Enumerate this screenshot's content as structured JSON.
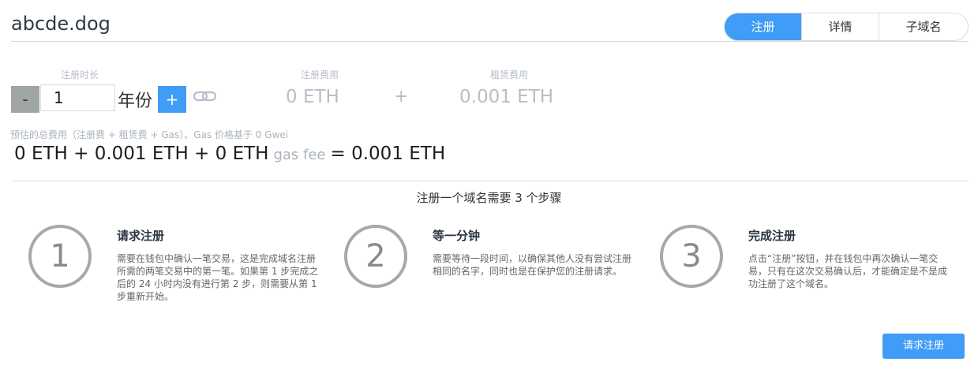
{
  "header": {
    "domain": "abcde.dog",
    "tabs": [
      {
        "label": "注册",
        "active": true
      },
      {
        "label": "详情",
        "active": false
      },
      {
        "label": "子域名",
        "active": false
      }
    ]
  },
  "registration": {
    "duration_label": "注册时长",
    "duration_value": "1",
    "duration_unit": "年份",
    "decrement_label": "-",
    "increment_label": "+",
    "reg_fee_label": "注册费用",
    "reg_fee_value": "0 ETH",
    "plus_symbol": "+",
    "rent_fee_label": "租赁费用",
    "rent_fee_value": "0.001 ETH",
    "estimate_note": "预估的总费用（注册费 + 租赁费 + Gas）。Gas 价格基于 0 Gwei",
    "total": {
      "part1": "0 ETH + 0.001 ETH + 0 ETH",
      "gas_label": "gas fee",
      "part2": "= 0.001 ETH"
    }
  },
  "steps": {
    "heading": "注册一个域名需要 3 个步骤",
    "items": [
      {
        "number": "1",
        "title": "请求注册",
        "desc": "需要在钱包中确认一笔交易，这是完成域名注册所需的两笔交易中的第一笔。如果第 1 步完成之后的 24 小时内没有进行第 2 步，则需要从第 1 步重新开始。"
      },
      {
        "number": "2",
        "title": "等一分钟",
        "desc": "需要等待一段时间，以确保其他人没有尝试注册相同的名字，同时也是在保护您的注册请求。"
      },
      {
        "number": "3",
        "title": "完成注册",
        "desc": "点击“注册”按钮，并在钱包中再次确认一笔交易，只有在这次交易确认后，才能确定是不是成功注册了这个域名。"
      }
    ]
  },
  "submit_label": "请求注册",
  "colors": {
    "accent": "#3f9cf7",
    "muted": "#b6bec8",
    "circle": "#a8a9a3"
  },
  "icons": {
    "link": "link-icon"
  }
}
